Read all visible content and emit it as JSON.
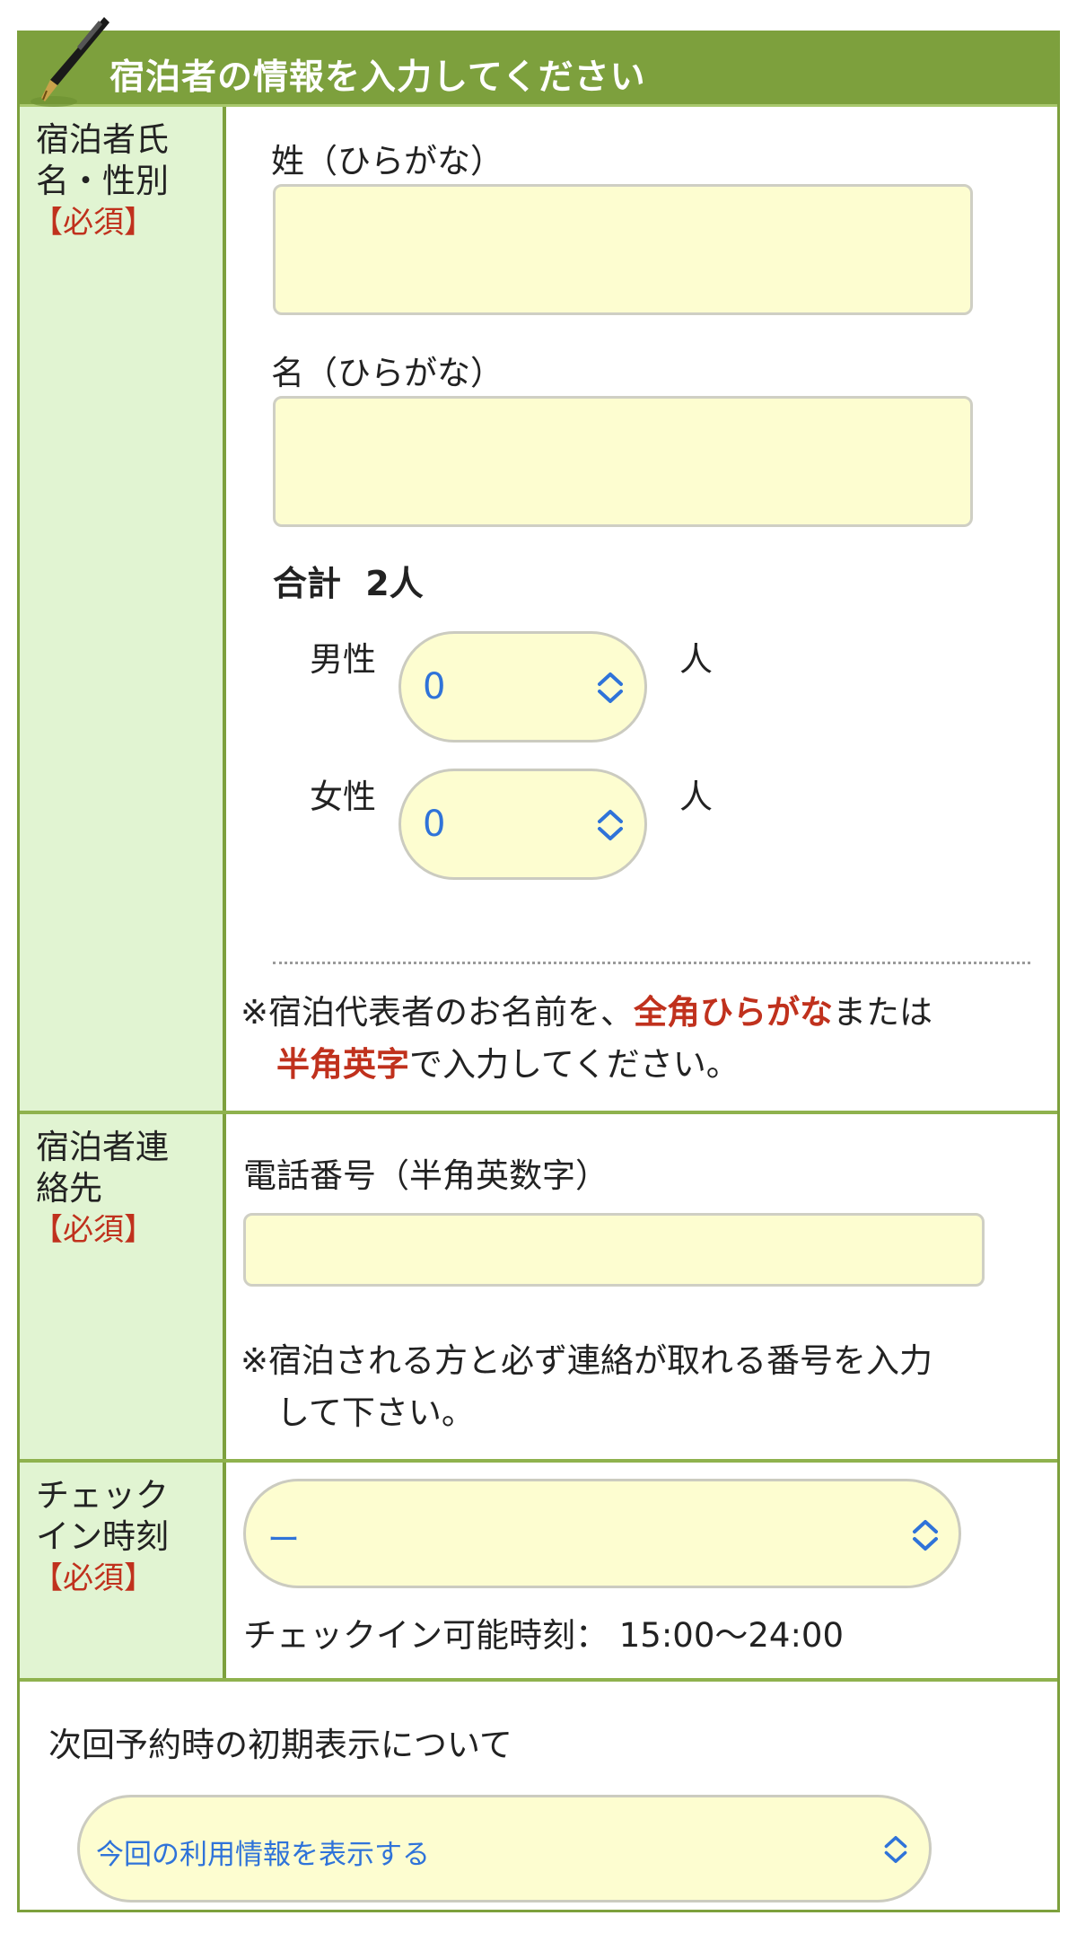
{
  "header": {
    "title": "宿泊者の情報を入力してください",
    "icon": "pen-icon"
  },
  "guest_name": {
    "label_line1": "宿泊者氏",
    "label_line2": "名・性別",
    "required": "【必須】",
    "last_name_label": "姓（ひらがな）",
    "last_name_value": "",
    "first_name_label": "名（ひらがな）",
    "first_name_value": "",
    "total_label": "合計",
    "total_value": "2人",
    "male_label": "男性",
    "male_value": "0",
    "male_unit": "人",
    "female_label": "女性",
    "female_value": "0",
    "female_unit": "人",
    "note_mark": "※",
    "note_part1": "宿泊代表者のお名前を、",
    "note_red1": "全角ひらがな",
    "note_part2": "または",
    "note_red2": "半角英字",
    "note_part3": "で入力してください。"
  },
  "contact": {
    "label_line1": "宿泊者連",
    "label_line2": "絡先",
    "required": "【必須】",
    "phone_label": "電話番号（半角英数字）",
    "phone_value": "",
    "note_mark": "※",
    "note_line1": "宿泊される方と必ず連絡が取れる番号を入力",
    "note_line2": "して下さい。"
  },
  "checkin": {
    "label_line1": "チェック",
    "label_line2": "イン時刻",
    "required": "【必須】",
    "select_value": "ー",
    "available_text": "チェックイン可能時刻： 15:00〜24:00"
  },
  "next_booking": {
    "label": "次回予約時の初期表示について",
    "select_value": "今回の利用情報を表示する"
  },
  "colors": {
    "accent": "#7da03d",
    "label_bg": "#e1f4d2",
    "input_bg": "#fdfdd0",
    "required": "#c0311d",
    "select_text": "#2f73d9"
  }
}
